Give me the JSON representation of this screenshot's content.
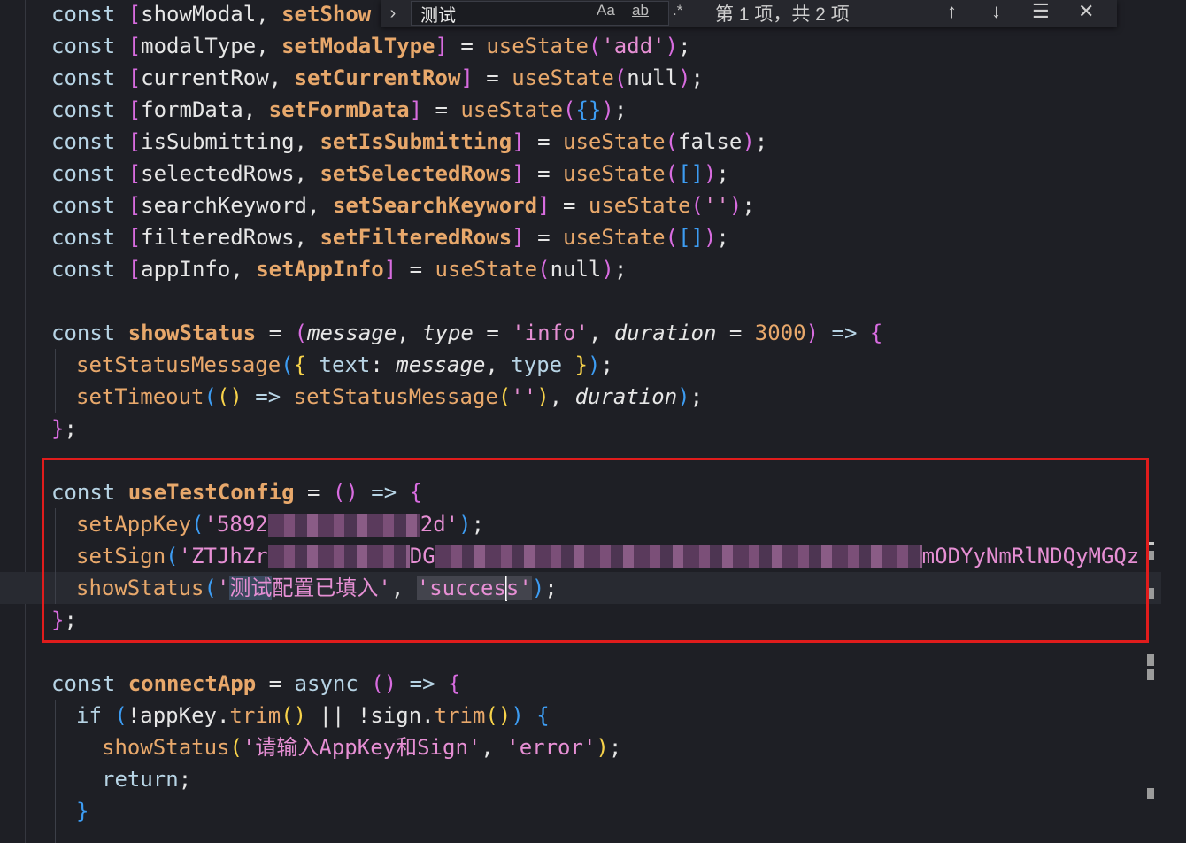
{
  "find": {
    "query": "测试",
    "match_case": "Aa",
    "whole_word": "ab",
    "regex": ".*",
    "result_count": "第 1 项，共 2 项"
  },
  "code": {
    "l1_var": "showModal",
    "l1_setter": "setShow",
    "l2_var": "modalType",
    "l2_setter": "setModalType",
    "l2_arg": "'add'",
    "l3_var": "currentRow",
    "l3_setter": "setCurrentRow",
    "l3_arg": "null",
    "l4_var": "formData",
    "l4_setter": "setFormData",
    "l5_var": "isSubmitting",
    "l5_setter": "setIsSubmitting",
    "l5_arg": "false",
    "l6_var": "selectedRows",
    "l6_setter": "setSelectedRows",
    "l7_var": "searchKeyword",
    "l7_setter": "setSearchKeyword",
    "l7_arg": "''",
    "l8_var": "filteredRows",
    "l8_setter": "setFilteredRows",
    "l9_var": "appInfo",
    "l9_setter": "setAppInfo",
    "l9_arg": "null",
    "kw_const": "const",
    "hook": "useState",
    "show_status_fn": "showStatus",
    "p_message": "message",
    "p_type": "type",
    "p_type_default": "'info'",
    "p_duration": "duration",
    "p_duration_default": "3000",
    "set_status_message": "setStatusMessage",
    "prop_text": "text",
    "set_timeout": "setTimeout",
    "empty_str": "''",
    "use_test_config_fn": "useTestConfig",
    "set_app_key": "setAppKey",
    "app_key_start": "'5892",
    "app_key_end": "2d'",
    "set_sign": "setSign",
    "sign_start": "'ZTJhZr",
    "sign_mid": "DG",
    "sign_end": "mODYyNmRlNDQyMGQz",
    "test_str_open": "'",
    "test_str_match": "测试",
    "test_str_rest": "配置已填入'",
    "success_a": "'succes",
    "success_b": "s'",
    "connect_app_fn": "connectApp",
    "kw_async": "async",
    "kw_if": "if",
    "app_key": "appKey",
    "sign": "sign",
    "trim": "trim",
    "error_msg": "'请输入AppKey和Sign'",
    "error_type": "'error'",
    "kw_return": "return"
  }
}
